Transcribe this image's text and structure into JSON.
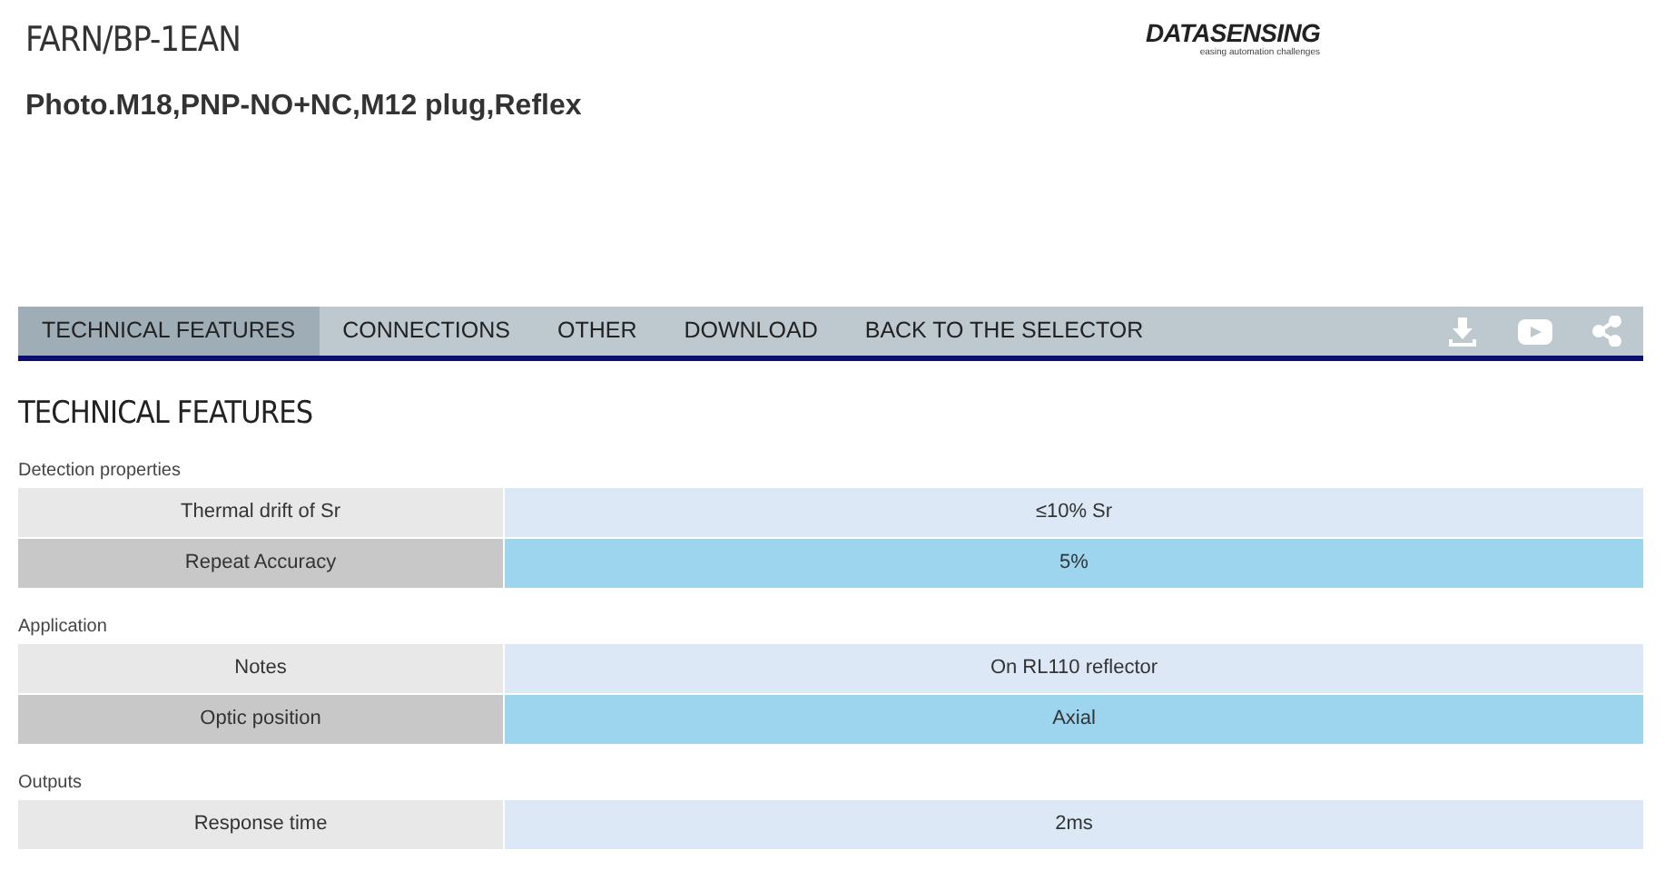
{
  "product": {
    "code": "FARN/BP-1EAN",
    "description": "Photo.M18,PNP-NO+NC,M12 plug,Reflex"
  },
  "logo": {
    "name": "DATASENSING",
    "tagline": "easing automation challenges"
  },
  "tabs": [
    {
      "label": "TECHNICAL FEATURES",
      "selected": true
    },
    {
      "label": "CONNECTIONS",
      "selected": false
    },
    {
      "label": "OTHER",
      "selected": false
    },
    {
      "label": "DOWNLOAD",
      "selected": false
    },
    {
      "label": "BACK TO THE SELECTOR",
      "selected": false
    }
  ],
  "section_title": "TECHNICAL FEATURES",
  "groups": [
    {
      "title": "Detection properties",
      "rows": [
        {
          "label": "Thermal drift of Sr",
          "value": "≤10% Sr"
        },
        {
          "label": "Repeat Accuracy",
          "value": "5%"
        }
      ]
    },
    {
      "title": "Application",
      "rows": [
        {
          "label": "Notes",
          "value": "On RL110 reflector"
        },
        {
          "label": "Optic position",
          "value": "Axial"
        }
      ]
    },
    {
      "title": "Outputs",
      "rows": [
        {
          "label": "Response time",
          "value": "2ms"
        }
      ]
    }
  ]
}
